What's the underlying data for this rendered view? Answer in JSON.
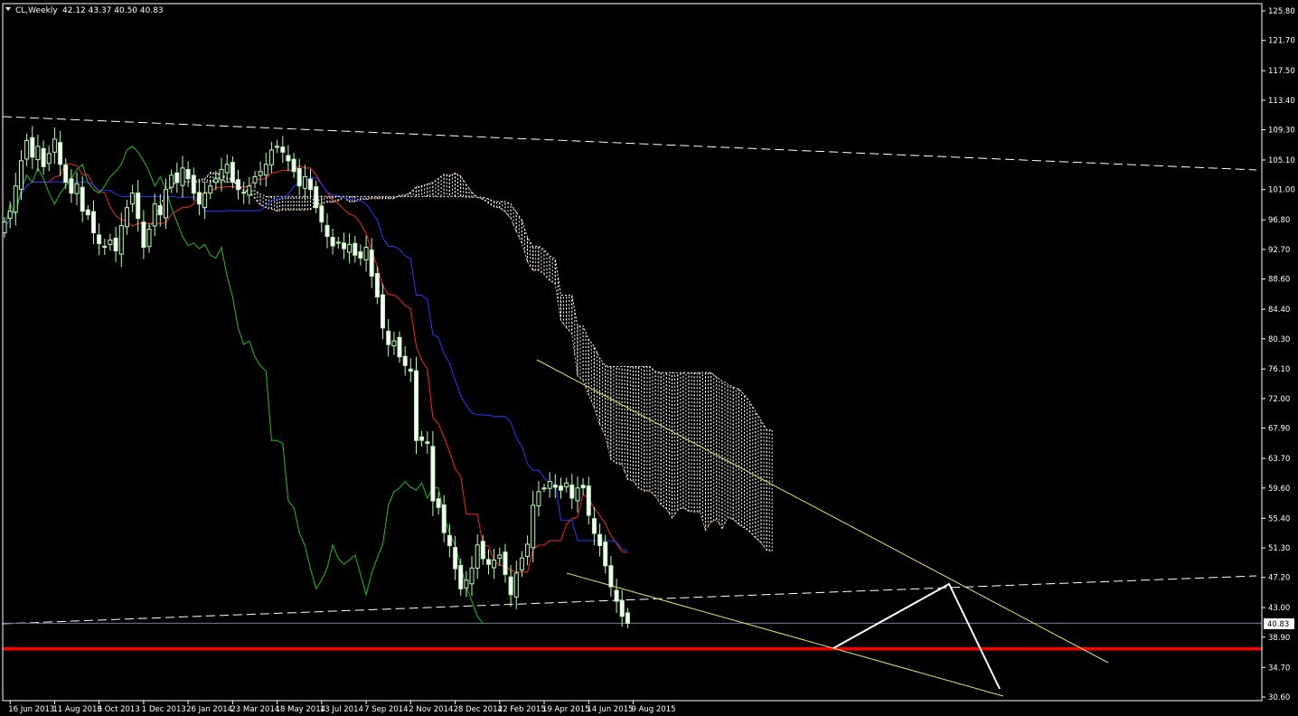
{
  "header": {
    "symbol": "CL,Weekly",
    "ohlc": "42.12 43.37 40.50 40.83"
  },
  "last_price_label": "40.83",
  "chart_data": {
    "type": "candlestick",
    "title": "CL,Weekly",
    "ylim": [
      30.6,
      125.8
    ],
    "y_ticks": [
      "125.80",
      "121.70",
      "117.50",
      "113.40",
      "109.30",
      "105.10",
      "101.00",
      "96.80",
      "92.70",
      "88.60",
      "84.40",
      "80.30",
      "76.10",
      "72.00",
      "67.90",
      "63.70",
      "59.60",
      "55.40",
      "51.30",
      "47.20",
      "43.00",
      "38.90",
      "34.70",
      "30.60"
    ],
    "x_ticks": [
      "16 Jun 2013",
      "11 Aug 2013",
      "6 Oct 2013",
      "1 Dec 2013",
      "26 Jan 2014",
      "23 Mar 2014",
      "18 May 2014",
      "13 Jul 2014",
      "7 Sep 2014",
      "2 Nov 2014",
      "28 Dec 2014",
      "22 Feb 2015",
      "19 Apr 2015",
      "14 Jun 2015",
      "9 Aug 2015"
    ],
    "last_price": 40.83,
    "support_level": 37.3,
    "close": [
      96.5,
      98.0,
      101.5,
      105.0,
      107.8,
      105.5,
      107.0,
      104.2,
      106.0,
      108.0,
      104.5,
      102.0,
      100.5,
      101.8,
      98.0,
      97.5,
      95.0,
      93.5,
      93.0,
      94.0,
      92.5,
      96.0,
      98.5,
      100.5,
      97.0,
      93.0,
      95.5,
      99.0,
      97.5,
      101.0,
      103.0,
      102.0,
      104.0,
      102.5,
      100.5,
      99.0,
      100.5,
      101.5,
      102.5,
      103.8,
      104.5,
      102.0,
      101.0,
      100.5,
      101.5,
      102.8,
      103.5,
      104.5,
      106.5,
      107.0,
      106.2,
      105.0,
      103.5,
      101.5,
      102.8,
      101.0,
      98.5,
      96.5,
      94.5,
      93.2,
      93.6,
      92.8,
      93.4,
      91.9,
      91.5,
      93.0,
      89.0,
      86.1,
      81.8,
      79.5,
      80.0,
      77.8,
      76.6,
      75.8,
      66.2,
      66.2,
      65.8,
      57.8,
      56.9,
      53.4,
      51.6,
      48.4,
      45.6,
      46.8,
      48.5,
      51.7,
      49.8,
      49.0,
      49.6,
      50.3,
      47.6,
      44.8,
      47.8,
      49.9,
      51.8,
      57.2,
      59.1,
      59.6,
      60.5,
      59.7,
      59.3,
      60.3,
      58.2,
      59.6,
      59.6,
      55.8,
      53.3,
      51.6,
      48.8,
      45.9,
      43.9,
      41.8,
      40.83
    ]
  }
}
